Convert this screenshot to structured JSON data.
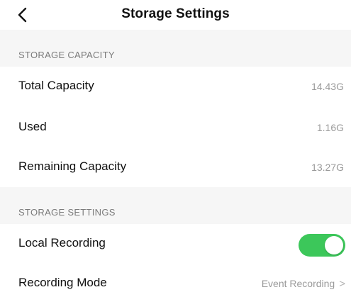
{
  "header": {
    "title": "Storage Settings",
    "back_icon": "chevron-left-icon"
  },
  "sections": {
    "capacity": {
      "label": "STORAGE CAPACITY",
      "rows": [
        {
          "label": "Total Capacity",
          "value": "14.43G"
        },
        {
          "label": "Used",
          "value": "1.16G"
        },
        {
          "label": "Remaining Capacity",
          "value": "13.27G"
        }
      ]
    },
    "settings": {
      "label": "STORAGE SETTINGS",
      "local_recording": {
        "label": "Local Recording",
        "enabled": true,
        "toggle_color": "#3cc75a"
      },
      "recording_mode": {
        "label": "Recording Mode",
        "value": "Event Recording",
        "chevron": ">"
      }
    }
  }
}
